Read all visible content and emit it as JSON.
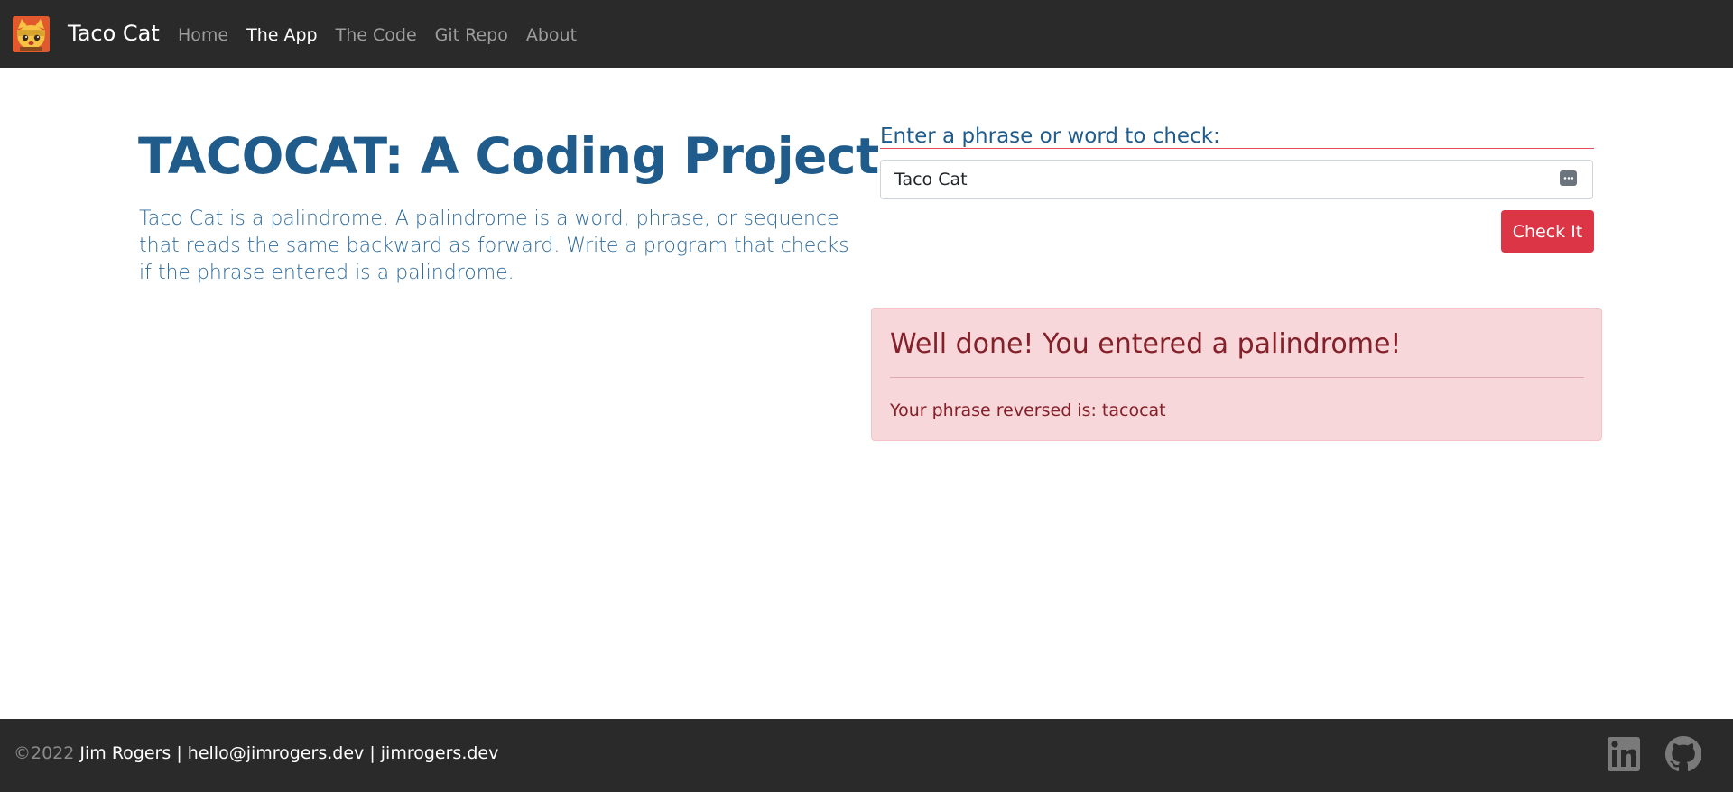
{
  "navbar": {
    "logo_icon": "taco-cat-logo-icon",
    "brand": "Taco Cat",
    "links": [
      {
        "label": "Home",
        "active": false
      },
      {
        "label": "The App",
        "active": true
      },
      {
        "label": "The Code",
        "active": false
      },
      {
        "label": "Git Repo",
        "active": false
      },
      {
        "label": "About",
        "active": false
      }
    ]
  },
  "hero": {
    "title": "TACOCAT: A Coding Project",
    "description": "Taco Cat is a palindrome. A palindrome is a word, phrase, or sequence that reads the same backward as forward. Write a program that checks if the phrase entered is a palindrome."
  },
  "form": {
    "label": "Enter a phrase or word to check:",
    "input_value": "Taco Cat",
    "input_icon": "password-manager-key-icon",
    "button_label": "Check It"
  },
  "alert": {
    "heading": "Well done! You entered a palindrome!",
    "body": "Your phrase reversed is: tacocat"
  },
  "footer": {
    "copyright": "©2022",
    "author": "Jim Rogers",
    "separator": "|",
    "email": "hello@jimrogers.dev",
    "website": "jimrogers.dev",
    "social_icons": [
      "linkedin-icon",
      "github-icon"
    ]
  },
  "colors": {
    "navbar_bg": "#2a2a2a",
    "heading_blue": "#1f5c8c",
    "danger_red": "#dc3545",
    "alert_bg": "#f8d7da",
    "alert_text": "#842029"
  }
}
